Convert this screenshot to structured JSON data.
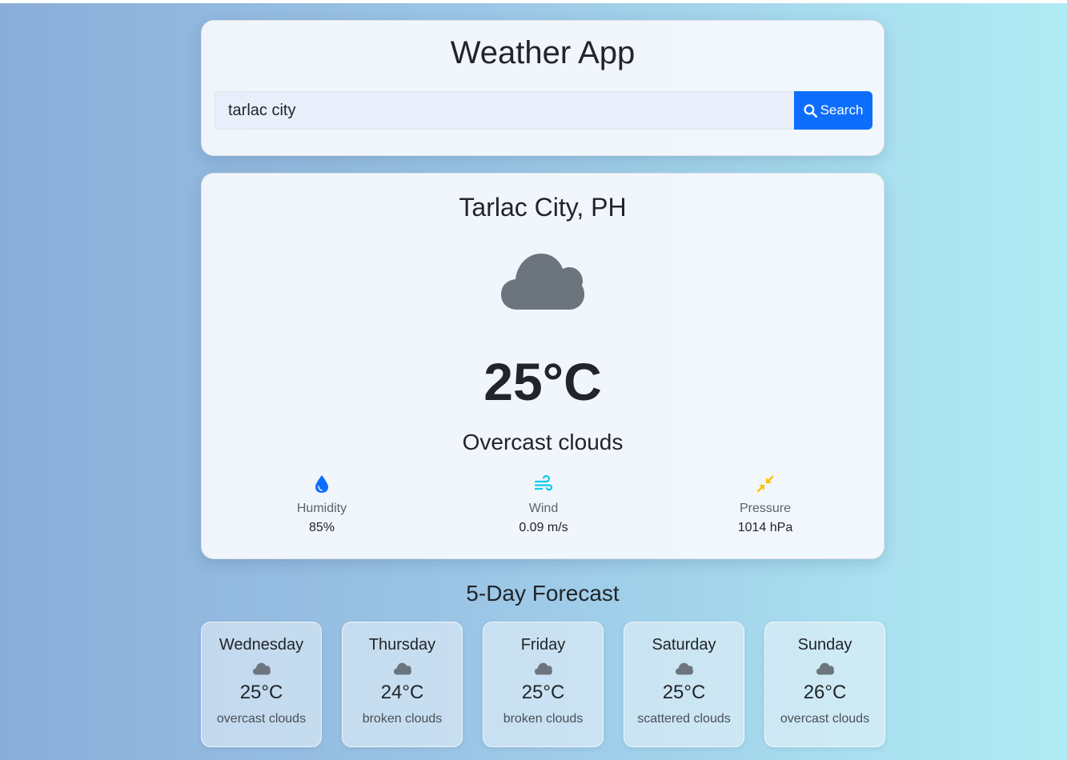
{
  "app": {
    "title": "Weather App"
  },
  "search": {
    "value": "tarlac city",
    "button_label": "Search",
    "button_color": "#0d6efd"
  },
  "current": {
    "location": "Tarlac City, PH",
    "icon": "cloud-icon",
    "temperature": "25°C",
    "description": "Overcast clouds",
    "details": [
      {
        "icon": "droplet-icon",
        "label": "Humidity",
        "value": "85%",
        "color": "#0d6efd"
      },
      {
        "icon": "wind-icon",
        "label": "Wind",
        "value": "0.09 m/s",
        "color": "#0dcaf0"
      },
      {
        "icon": "compress-arrows-icon",
        "label": "Pressure",
        "value": "1014 hPa",
        "color": "#ffc107"
      }
    ]
  },
  "forecast": {
    "title": "5-Day Forecast",
    "days": [
      {
        "day": "Wednesday",
        "icon": "cloud-icon",
        "temp": "25°C",
        "desc": "overcast clouds"
      },
      {
        "day": "Thursday",
        "icon": "cloud-icon",
        "temp": "24°C",
        "desc": "broken clouds"
      },
      {
        "day": "Friday",
        "icon": "cloud-icon",
        "temp": "25°C",
        "desc": "broken clouds"
      },
      {
        "day": "Saturday",
        "icon": "cloud-icon",
        "temp": "25°C",
        "desc": "scattered clouds"
      },
      {
        "day": "Sunday",
        "icon": "cloud-icon",
        "temp": "26°C",
        "desc": "overcast clouds"
      }
    ]
  }
}
